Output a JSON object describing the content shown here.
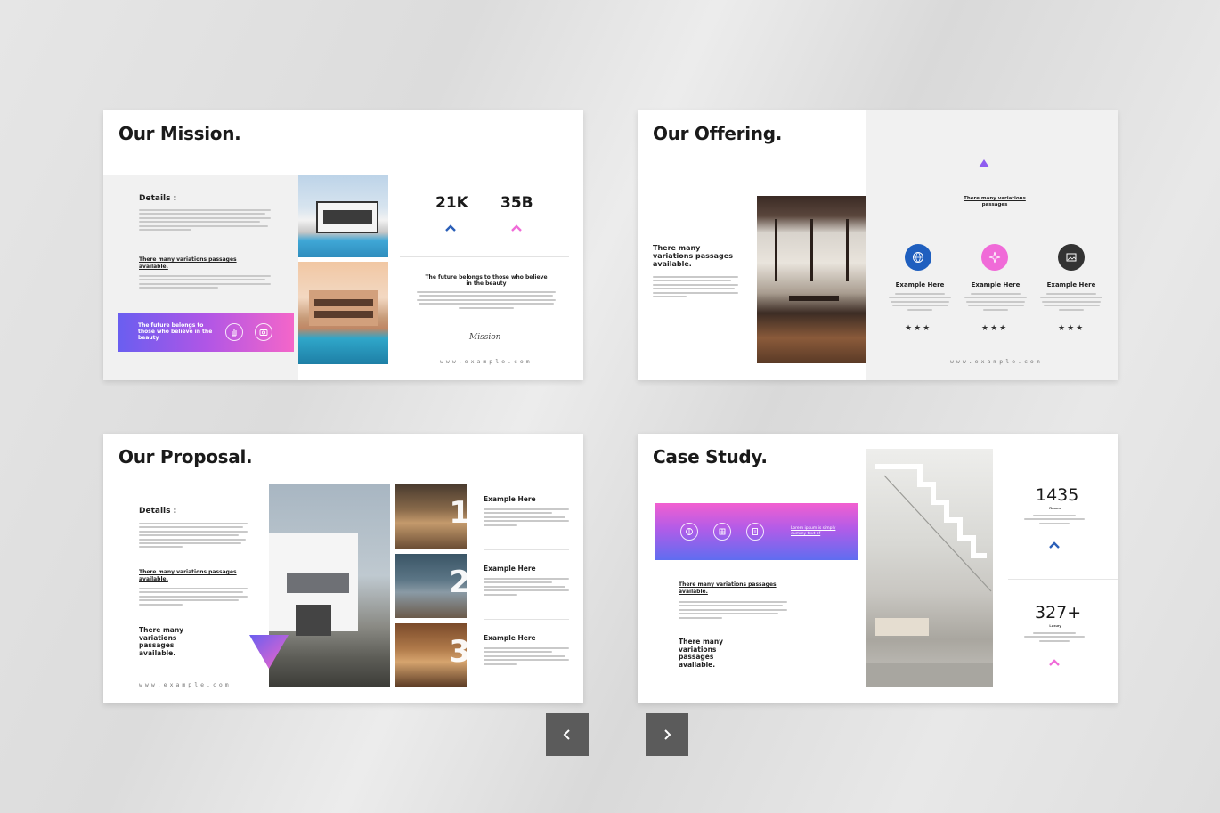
{
  "slides": {
    "mission": {
      "title": "Our Mission.",
      "details_heading": "Details :",
      "link_heading": "There many variations passages available.",
      "banner_text": "The future belongs to those who believe in the beauty",
      "stat1": "21K",
      "stat2": "35B",
      "quote_heading": "The future belongs to those who believe in the beauty",
      "signature": "Mission",
      "website": "www.example.com"
    },
    "offering": {
      "title": "Our Offering.",
      "left_heading": "There many variations passages available.",
      "right_link": "There many variations passages",
      "features": [
        {
          "label": "Example Here",
          "stars": "★★★",
          "color": "#1f5fbf"
        },
        {
          "label": "Example Here",
          "stars": "★★★",
          "color": "#f06bd8"
        },
        {
          "label": "Example Here",
          "stars": "★★★",
          "color": "#333333"
        }
      ],
      "website": "www.example.com"
    },
    "proposal": {
      "title": "Our Proposal.",
      "details_heading": "Details :",
      "link_heading": "There many variations passages available.",
      "bottom_heading": "There many variations passages available.",
      "items": [
        {
          "label": "Example Here",
          "num": "1"
        },
        {
          "label": "Example Here",
          "num": "2"
        },
        {
          "label": "Example Here",
          "num": "3"
        }
      ],
      "website": "www.example.com"
    },
    "case_study": {
      "title": "Case Study.",
      "banner_link": "Lorem ipsum is simply dummy text of",
      "link_heading": "There many variations passages available.",
      "bottom_heading": "There many variations passages available.",
      "stat1": "1435",
      "stat1_label": "Rooms",
      "stat2": "327+",
      "stat2_label": "Luxury"
    }
  },
  "nav": {
    "prev_icon": "chevron-left-icon",
    "next_icon": "chevron-right-icon"
  },
  "colors": {
    "accent_blue": "#2b5fb8",
    "accent_pink": "#f06bd8",
    "nav_button": "#5b5b5b"
  }
}
